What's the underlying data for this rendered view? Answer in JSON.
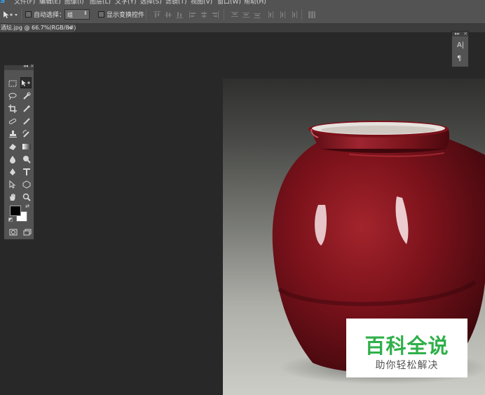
{
  "menubar": {
    "logo": "S",
    "items": [
      "文件(F)",
      "编辑(E)",
      "图像(I)",
      "图层(L)",
      "文字(Y)",
      "选择(S)",
      "滤镜(T)",
      "视图(V)",
      "窗口(W)",
      "帮助(H)"
    ]
  },
  "options": {
    "tool_preset_icon": "move-arrow-icon",
    "auto_select_label": "自动选择：",
    "auto_select_value": "组",
    "show_transform_label": "显示变换控件"
  },
  "document": {
    "tab_label": "酒坛.jpg @ 66.7%(RGB/8#)",
    "tab_close": "×"
  },
  "toolbox": {
    "collapse_label": "◂◂",
    "close_label": "×"
  },
  "minipanel": {
    "collapse_label": "▸▸",
    "close_label": "×",
    "character_glyph": "A|",
    "paragraph_glyph": "¶"
  },
  "colors": {
    "foreground": "#000000",
    "background": "#ffffff",
    "accent": "#2fb04a"
  },
  "watermark": {
    "title": "百科全说",
    "subtitle": "助你轻松解决"
  }
}
